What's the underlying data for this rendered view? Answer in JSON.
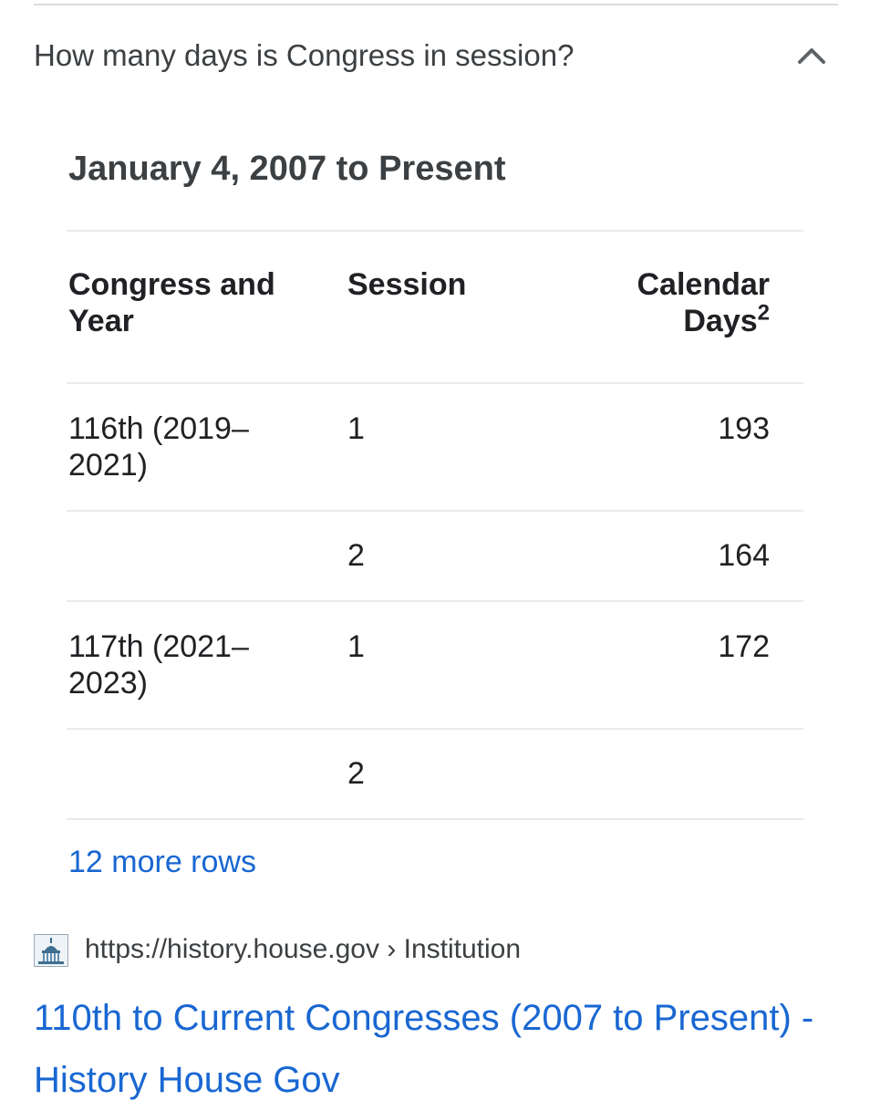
{
  "faq": {
    "question": "How many days is Congress in session?",
    "expand_icon": "chevron-up-icon"
  },
  "table": {
    "title": "January 4, 2007 to Present",
    "headers": {
      "congress_year": "Congress and Year",
      "session": "Session",
      "calendar_days": "Calendar Days",
      "calendar_days_sup": "2"
    },
    "rows": [
      {
        "congress_year": "116th (2019–2021)",
        "session": "1",
        "calendar_days": "193"
      },
      {
        "congress_year": "",
        "session": "2",
        "calendar_days": "164"
      },
      {
        "congress_year": "117th (2021–2023)",
        "session": "1",
        "calendar_days": "172"
      },
      {
        "congress_year": "",
        "session": "2",
        "calendar_days": ""
      }
    ],
    "more_rows_label": "12 more rows"
  },
  "source": {
    "favicon_icon": "capitol-building-icon",
    "url": "https://history.house.gov › Institution",
    "title": "110th to Current Congresses (2007 to Present) - History House Gov"
  },
  "colors": {
    "link": "#1967d2",
    "divider": "#e8eaed",
    "text": "#202124"
  }
}
